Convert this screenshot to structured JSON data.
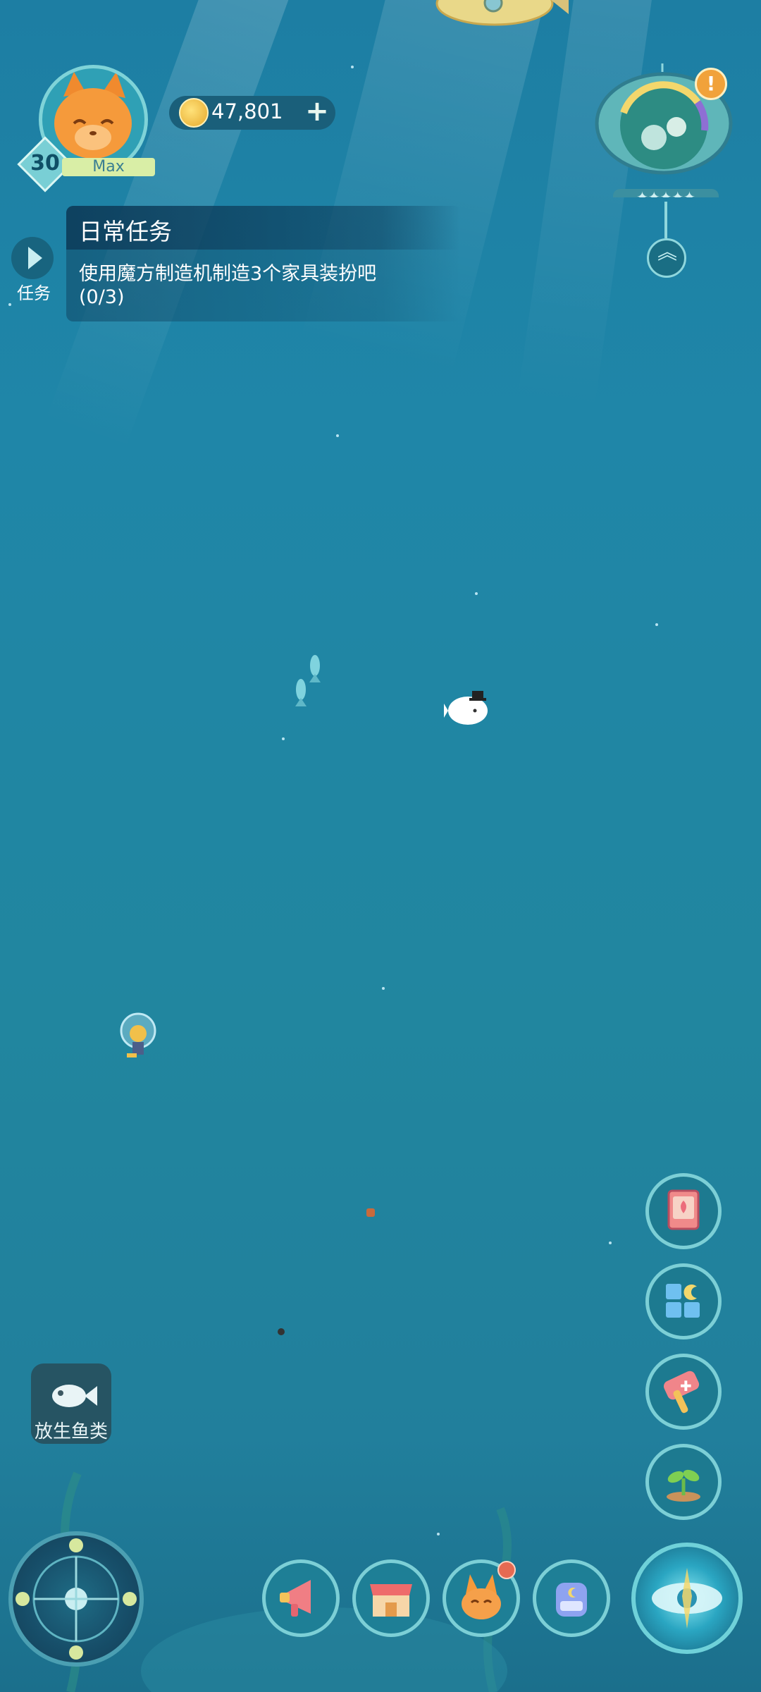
{
  "player": {
    "level": "30",
    "level_status": "Max",
    "avatar_icon": "orange-cat-face"
  },
  "currency": {
    "coins": "47,801",
    "add_icon": "plus-icon"
  },
  "quest": {
    "button_label": "任务",
    "title": "日常任务",
    "description": "使用魔方制造机制造3个家具装扮吧",
    "progress": "(0/3)"
  },
  "release_fish": {
    "label": "放生鱼类",
    "icon": "fish-icon"
  },
  "side_buttons": [
    {
      "name": "guide-book-icon"
    },
    {
      "name": "decorate-icon"
    },
    {
      "name": "hammer-icon"
    },
    {
      "name": "sprout-icon"
    }
  ],
  "bottom_buttons": [
    {
      "name": "megaphone-icon"
    },
    {
      "name": "shop-icon"
    },
    {
      "name": "fox-icon",
      "notification": true
    },
    {
      "name": "backpack-icon"
    }
  ],
  "colors": {
    "ocean": "#21869f",
    "panel": "#0f4664",
    "accent": "#7ccfd6",
    "coin": "#f0c04a",
    "notification": "#e66a52"
  }
}
